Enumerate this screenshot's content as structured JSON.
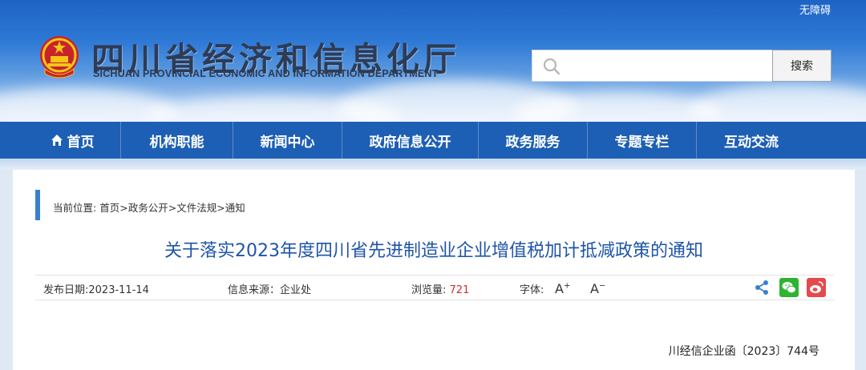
{
  "header": {
    "accessibility_label": "无障碍",
    "org_name_cn": "四川省经济和信息化厅",
    "org_name_en": "SICHUAN PROVINCIAL ECONOMIC AND INFORMATION DEPARTMENT",
    "search": {
      "value": "",
      "placeholder": "",
      "button_label": "搜索"
    }
  },
  "nav": {
    "items": [
      {
        "label": "首页",
        "icon": "home-icon"
      },
      {
        "label": "机构职能"
      },
      {
        "label": "新闻中心"
      },
      {
        "label": "政府信息公开"
      },
      {
        "label": "政务服务"
      },
      {
        "label": "专题专栏"
      },
      {
        "label": "互动交流"
      }
    ]
  },
  "breadcrumb": {
    "prefix": "当前位置:",
    "items": [
      "首页",
      "政务公开",
      "文件法规",
      "通知"
    ],
    "separator": ">"
  },
  "article": {
    "title": "关于落实2023年度四川省先进制造业企业增值税加计抵减政策的通知",
    "publish_label": "发布日期:",
    "publish_date": "2023-11-14",
    "source_label": "信息来源：",
    "source": "企业处",
    "views_label": "浏览量:",
    "views": "721",
    "font_label": "字体:",
    "font_increase": "A",
    "font_decrease": "A",
    "doc_number": "川经信企业函〔2023〕744号"
  },
  "colors": {
    "nav_bg": "#1d5fb4",
    "title": "#1f55a8",
    "views": "#d42b2b",
    "wechat": "#2db431",
    "weibo": "#e6494c",
    "share": "#3b7fd1"
  }
}
